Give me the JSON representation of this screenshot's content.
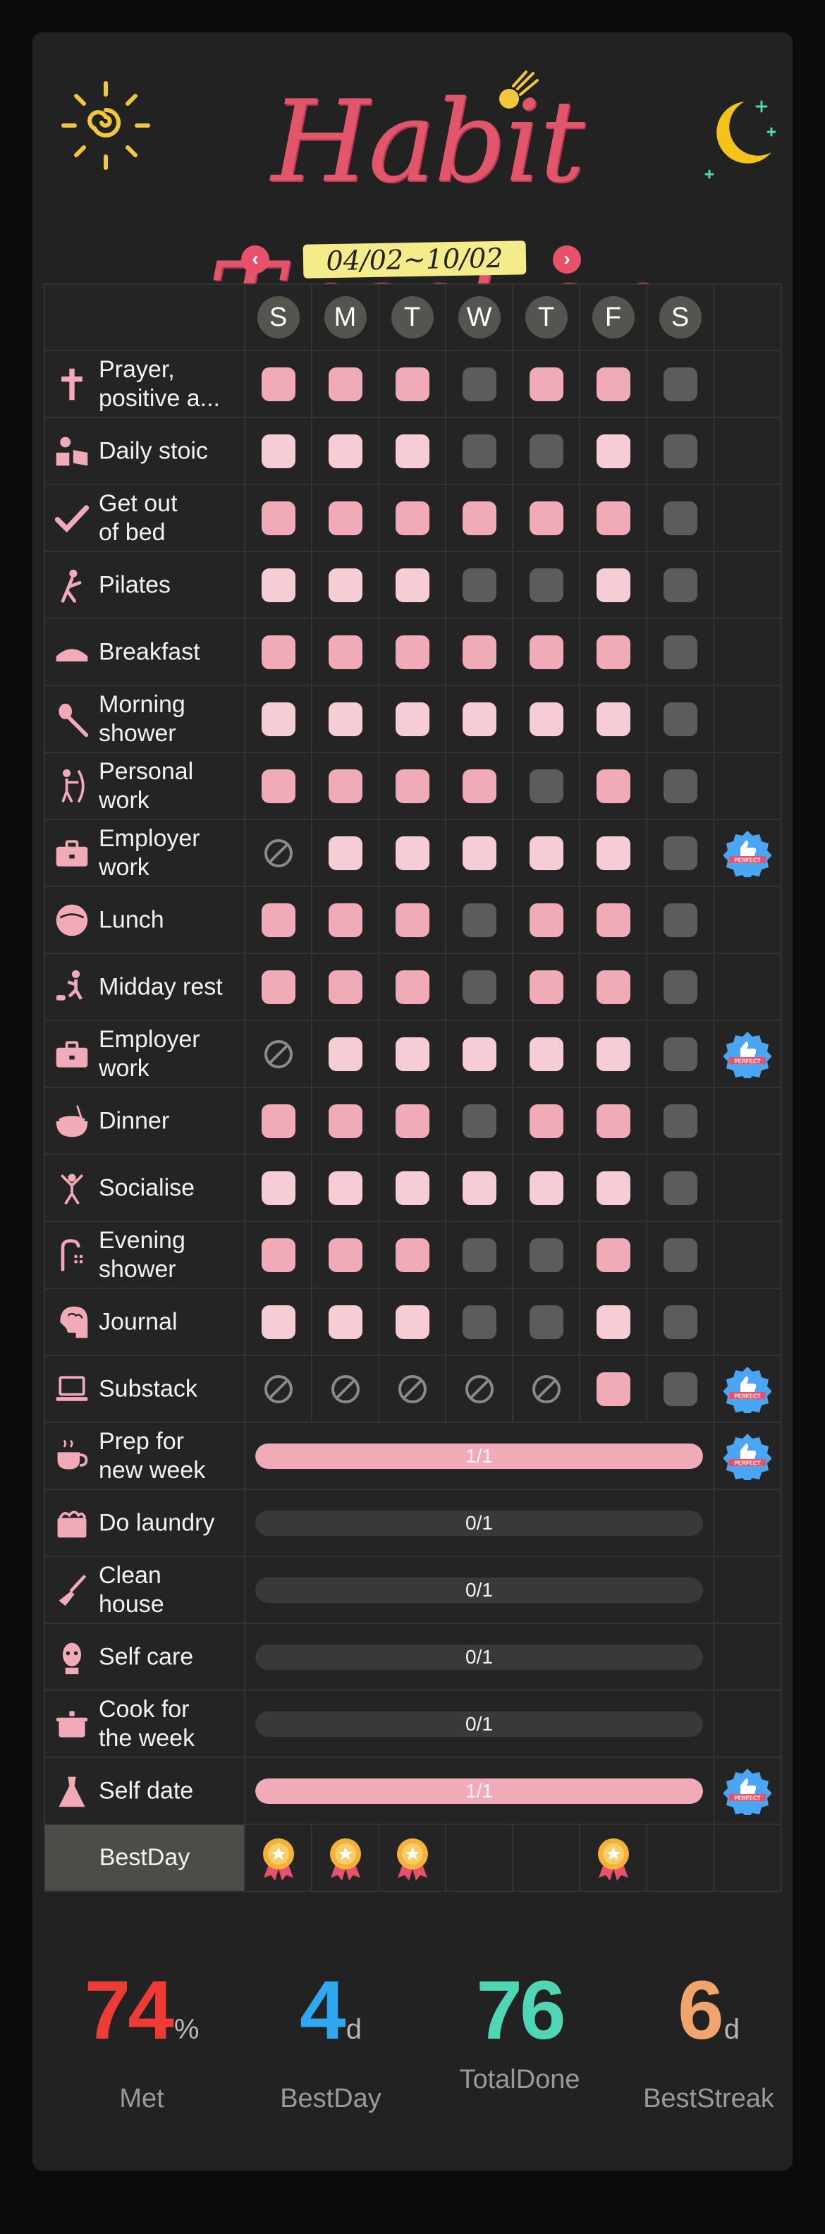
{
  "header": {
    "title": "Habit Tracker",
    "date_range": "04/02~10/02",
    "prev_icon": "chevron-left-icon",
    "next_icon": "chevron-right-icon"
  },
  "colors": {
    "background": "#222222",
    "accent_pink": "#f0aab8",
    "light_pink": "#f7cdd5",
    "inactive_gray": "#5c5c5c",
    "title_pink": "#e2566b"
  },
  "days": [
    "S",
    "M",
    "T",
    "W",
    "T",
    "F",
    "S"
  ],
  "habits": [
    {
      "name": "Prayer,\npositive a...",
      "icon": "cross-icon",
      "cells": [
        "pink",
        "pink",
        "pink",
        "gray",
        "pink",
        "pink",
        "gray"
      ],
      "badge": false
    },
    {
      "name": "Daily stoic",
      "icon": "reading-icon",
      "cells": [
        "lpink",
        "lpink",
        "lpink",
        "gray",
        "gray",
        "lpink",
        "gray"
      ],
      "badge": false
    },
    {
      "name": "Get out\nof bed",
      "icon": "checkmark-icon",
      "cells": [
        "pink",
        "pink",
        "pink",
        "pink",
        "pink",
        "pink",
        "gray"
      ],
      "badge": false
    },
    {
      "name": "Pilates",
      "icon": "stretch-icon",
      "cells": [
        "lpink",
        "lpink",
        "lpink",
        "gray",
        "gray",
        "lpink",
        "gray"
      ],
      "badge": false
    },
    {
      "name": "Breakfast",
      "icon": "bread-icon",
      "cells": [
        "pink",
        "pink",
        "pink",
        "pink",
        "pink",
        "pink",
        "gray"
      ],
      "badge": false
    },
    {
      "name": "Morning\nshower",
      "icon": "brush-icon",
      "cells": [
        "lpink",
        "lpink",
        "lpink",
        "lpink",
        "lpink",
        "lpink",
        "gray"
      ],
      "badge": false
    },
    {
      "name": "Personal\nwork",
      "icon": "archer-icon",
      "cells": [
        "pink",
        "pink",
        "pink",
        "pink",
        "gray",
        "pink",
        "gray"
      ],
      "badge": false
    },
    {
      "name": "Employer\nwork",
      "icon": "briefcase-icon",
      "cells": [
        "skip",
        "lpink",
        "lpink",
        "lpink",
        "lpink",
        "lpink",
        "gray"
      ],
      "badge": true
    },
    {
      "name": "Lunch",
      "icon": "noodle-bowl-icon",
      "cells": [
        "pink",
        "pink",
        "pink",
        "gray",
        "pink",
        "pink",
        "gray"
      ],
      "badge": false
    },
    {
      "name": "Midday rest",
      "icon": "person-dog-icon",
      "cells": [
        "pink",
        "pink",
        "pink",
        "gray",
        "pink",
        "pink",
        "gray"
      ],
      "badge": false
    },
    {
      "name": "Employer\nwork",
      "icon": "briefcase-icon",
      "cells": [
        "skip",
        "lpink",
        "lpink",
        "lpink",
        "lpink",
        "lpink",
        "gray"
      ],
      "badge": true
    },
    {
      "name": "Dinner",
      "icon": "rice-bowl-icon",
      "cells": [
        "pink",
        "pink",
        "pink",
        "gray",
        "pink",
        "pink",
        "gray"
      ],
      "badge": false
    },
    {
      "name": "Socialise",
      "icon": "dancer-icon",
      "cells": [
        "lpink",
        "lpink",
        "lpink",
        "lpink",
        "lpink",
        "lpink",
        "gray"
      ],
      "badge": false
    },
    {
      "name": "Evening\nshower",
      "icon": "shower-icon",
      "cells": [
        "pink",
        "pink",
        "pink",
        "gray",
        "gray",
        "pink",
        "gray"
      ],
      "badge": false
    },
    {
      "name": "Journal",
      "icon": "head-brain-icon",
      "cells": [
        "lpink",
        "lpink",
        "lpink",
        "gray",
        "gray",
        "lpink",
        "gray"
      ],
      "badge": false
    },
    {
      "name": "Substack",
      "icon": "laptop-icon",
      "cells": [
        "skip",
        "skip",
        "skip",
        "skip",
        "skip",
        "pink",
        "gray"
      ],
      "badge": true
    }
  ],
  "weekly_habits": [
    {
      "name": "Prep for\nnew week",
      "icon": "teacup-icon",
      "done": 1,
      "goal": 1,
      "label": "1/1",
      "badge": true
    },
    {
      "name": "Do laundry",
      "icon": "laundry-basket-icon",
      "done": 0,
      "goal": 1,
      "label": "0/1",
      "badge": false
    },
    {
      "name": "Clean\nhouse",
      "icon": "broom-icon",
      "done": 0,
      "goal": 1,
      "label": "0/1",
      "badge": false
    },
    {
      "name": "Self care",
      "icon": "face-mask-icon",
      "done": 0,
      "goal": 1,
      "label": "0/1",
      "badge": false
    },
    {
      "name": "Cook for\nthe week",
      "icon": "cooking-pot-icon",
      "done": 0,
      "goal": 1,
      "label": "0/1",
      "badge": false
    },
    {
      "name": "Self date",
      "icon": "dress-icon",
      "done": 1,
      "goal": 1,
      "label": "1/1",
      "badge": true
    }
  ],
  "best_day": {
    "label": "BestDay",
    "medals": [
      true,
      true,
      true,
      false,
      false,
      true,
      false
    ],
    "icon": "medal-icon"
  },
  "badge": {
    "text": "PERFECT",
    "icon": "perfect-thumbs-up-badge-icon"
  },
  "stats": [
    {
      "value": "74",
      "unit": "%",
      "label": "Met",
      "color": "#ef3b36"
    },
    {
      "value": "4",
      "unit": "d",
      "label": "BestDay",
      "color": "#2ea8f0"
    },
    {
      "value": "76",
      "unit": "",
      "label": "TotalDone",
      "color": "#4fd6b4"
    },
    {
      "value": "6",
      "unit": "d",
      "label": "BestStreak",
      "color": "#f1a46c"
    }
  ]
}
